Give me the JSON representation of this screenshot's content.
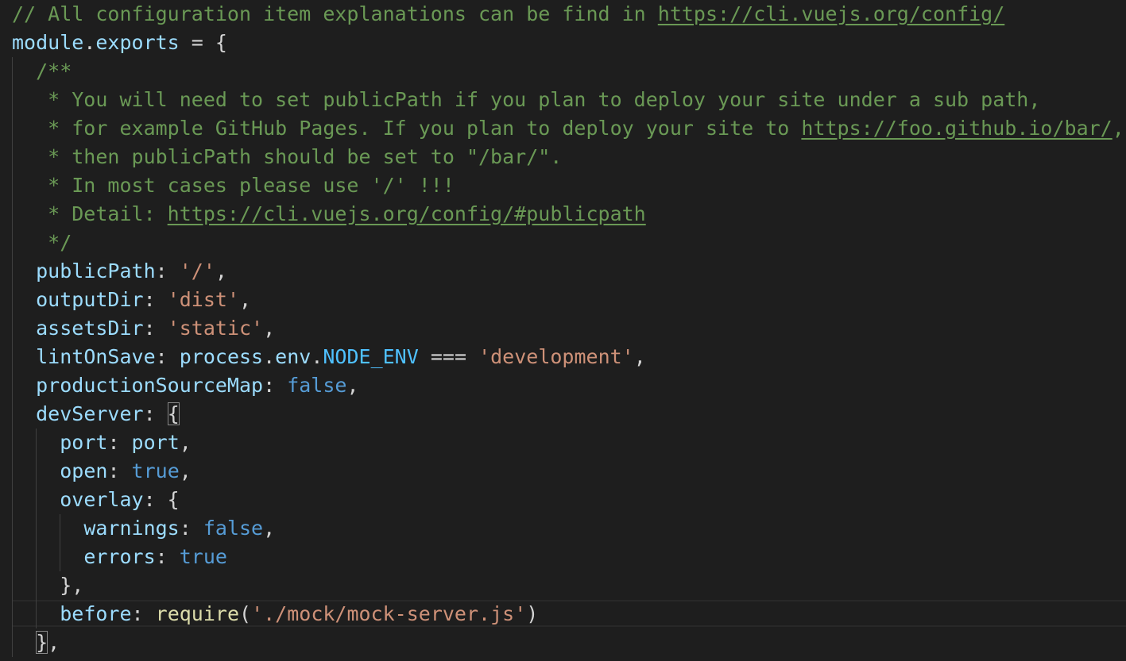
{
  "lines": [
    [
      {
        "t": "// All configuration item explanations can be find in ",
        "c": "c-comment"
      },
      {
        "t": "https://cli.vuejs.org/config/",
        "c": "c-link"
      }
    ],
    [
      {
        "t": "module",
        "c": "c-var"
      },
      {
        "t": ".",
        "c": "c-punc"
      },
      {
        "t": "exports",
        "c": "c-var"
      },
      {
        "t": " = {",
        "c": "c-punc"
      }
    ],
    [
      {
        "t": "  /**",
        "c": "c-comment"
      }
    ],
    [
      {
        "t": "   * You will need to set publicPath if you plan to deploy your site under a sub path,",
        "c": "c-comment"
      }
    ],
    [
      {
        "t": "   * for example GitHub Pages. If you plan to deploy your site to ",
        "c": "c-comment"
      },
      {
        "t": "https://foo.github.io/bar/",
        "c": "c-link"
      },
      {
        "t": ",",
        "c": "c-comment"
      }
    ],
    [
      {
        "t": "   * then publicPath should be set to \"/bar/\".",
        "c": "c-comment"
      }
    ],
    [
      {
        "t": "   * In most cases please use '/' !!!",
        "c": "c-comment"
      }
    ],
    [
      {
        "t": "   * Detail: ",
        "c": "c-comment"
      },
      {
        "t": "https://cli.vuejs.org/config/#publicpath",
        "c": "c-link"
      }
    ],
    [
      {
        "t": "   */",
        "c": "c-comment"
      }
    ],
    [
      {
        "t": "  ",
        "c": "c-punc"
      },
      {
        "t": "publicPath",
        "c": "c-prop"
      },
      {
        "t": ": ",
        "c": "c-punc"
      },
      {
        "t": "'/'",
        "c": "c-str"
      },
      {
        "t": ",",
        "c": "c-punc"
      }
    ],
    [
      {
        "t": "  ",
        "c": "c-punc"
      },
      {
        "t": "outputDir",
        "c": "c-prop"
      },
      {
        "t": ": ",
        "c": "c-punc"
      },
      {
        "t": "'dist'",
        "c": "c-str"
      },
      {
        "t": ",",
        "c": "c-punc"
      }
    ],
    [
      {
        "t": "  ",
        "c": "c-punc"
      },
      {
        "t": "assetsDir",
        "c": "c-prop"
      },
      {
        "t": ": ",
        "c": "c-punc"
      },
      {
        "t": "'static'",
        "c": "c-str"
      },
      {
        "t": ",",
        "c": "c-punc"
      }
    ],
    [
      {
        "t": "  ",
        "c": "c-punc"
      },
      {
        "t": "lintOnSave",
        "c": "c-prop"
      },
      {
        "t": ": ",
        "c": "c-punc"
      },
      {
        "t": "process",
        "c": "c-var"
      },
      {
        "t": ".",
        "c": "c-punc"
      },
      {
        "t": "env",
        "c": "c-var"
      },
      {
        "t": ".",
        "c": "c-punc"
      },
      {
        "t": "NODE_ENV",
        "c": "c-const"
      },
      {
        "t": " === ",
        "c": "c-punc"
      },
      {
        "t": "'development'",
        "c": "c-str"
      },
      {
        "t": ",",
        "c": "c-punc"
      }
    ],
    [
      {
        "t": "  ",
        "c": "c-punc"
      },
      {
        "t": "productionSourceMap",
        "c": "c-prop"
      },
      {
        "t": ": ",
        "c": "c-punc"
      },
      {
        "t": "false",
        "c": "c-kw"
      },
      {
        "t": ",",
        "c": "c-punc"
      }
    ],
    [
      {
        "t": "  ",
        "c": "c-punc"
      },
      {
        "t": "devServer",
        "c": "c-prop"
      },
      {
        "t": ": ",
        "c": "c-punc"
      },
      {
        "t": "{",
        "c": "c-punc bracket-hl"
      }
    ],
    [
      {
        "t": "    ",
        "c": "c-punc"
      },
      {
        "t": "port",
        "c": "c-prop"
      },
      {
        "t": ": ",
        "c": "c-punc"
      },
      {
        "t": "port",
        "c": "c-var"
      },
      {
        "t": ",",
        "c": "c-punc"
      }
    ],
    [
      {
        "t": "    ",
        "c": "c-punc"
      },
      {
        "t": "open",
        "c": "c-prop"
      },
      {
        "t": ": ",
        "c": "c-punc"
      },
      {
        "t": "true",
        "c": "c-kw"
      },
      {
        "t": ",",
        "c": "c-punc"
      }
    ],
    [
      {
        "t": "    ",
        "c": "c-punc"
      },
      {
        "t": "overlay",
        "c": "c-prop"
      },
      {
        "t": ": {",
        "c": "c-punc"
      }
    ],
    [
      {
        "t": "      ",
        "c": "c-punc"
      },
      {
        "t": "warnings",
        "c": "c-prop"
      },
      {
        "t": ": ",
        "c": "c-punc"
      },
      {
        "t": "false",
        "c": "c-kw"
      },
      {
        "t": ",",
        "c": "c-punc"
      }
    ],
    [
      {
        "t": "      ",
        "c": "c-punc"
      },
      {
        "t": "errors",
        "c": "c-prop"
      },
      {
        "t": ": ",
        "c": "c-punc"
      },
      {
        "t": "true",
        "c": "c-kw"
      }
    ],
    [
      {
        "t": "    },",
        "c": "c-punc"
      }
    ],
    [
      {
        "t": "    ",
        "c": "c-punc"
      },
      {
        "t": "before",
        "c": "c-prop"
      },
      {
        "t": ": ",
        "c": "c-punc"
      },
      {
        "t": "require",
        "c": "c-fn"
      },
      {
        "t": "(",
        "c": "c-punc"
      },
      {
        "t": "'./mock/mock-server.js'",
        "c": "c-str"
      },
      {
        "t": ")",
        "c": "c-punc"
      }
    ],
    [
      {
        "t": "  ",
        "c": "c-punc"
      },
      {
        "t": "}",
        "c": "c-punc bracket-hl"
      },
      {
        "t": ",",
        "c": "c-punc"
      }
    ]
  ],
  "current_line": 21
}
